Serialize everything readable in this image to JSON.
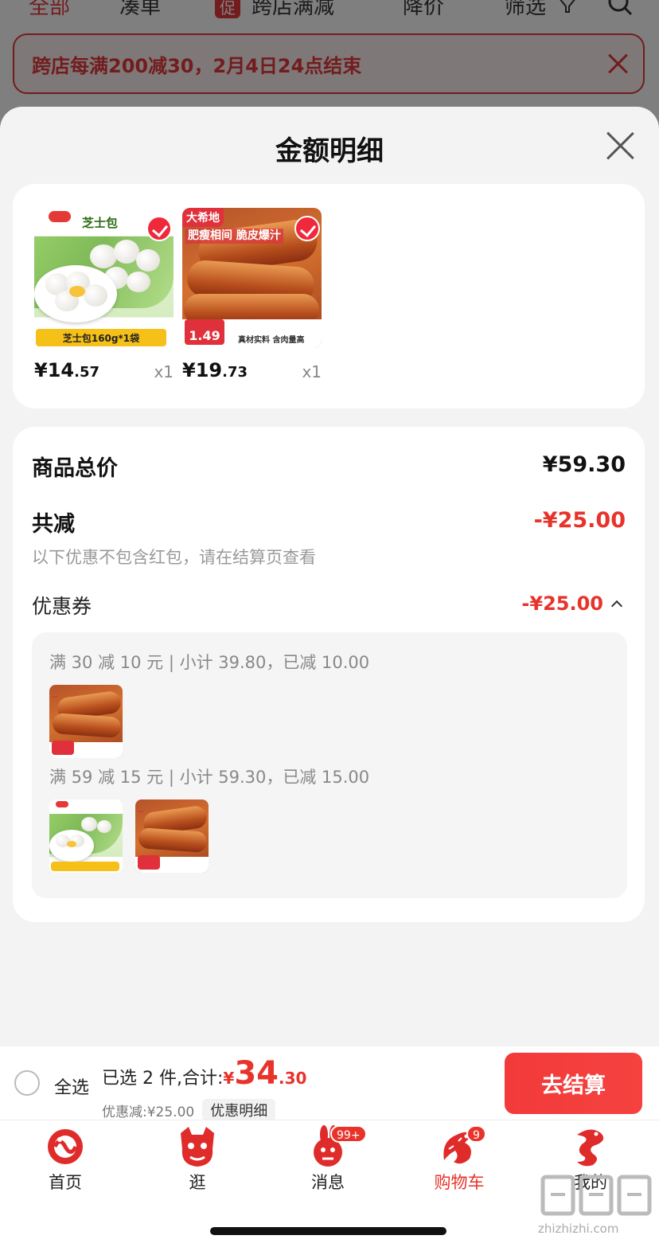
{
  "background": {
    "tabs": [
      "全部",
      "凑单",
      "跨店满减",
      "降价",
      "筛选"
    ],
    "promo_badge": "促",
    "banner_text": "跨店每满200减30，2月4日24点结束"
  },
  "sheet": {
    "title": "金额明细",
    "products": [
      {
        "name": "芝士包",
        "image_caption": "芝士包160g*1袋",
        "price_main": "¥14",
        "price_decimal": ".57",
        "qty": "x1"
      },
      {
        "name": "大希地",
        "slogan": "肥瘦相间 脆皮爆汁",
        "price_tag": "1.49",
        "image_caption": "真材实料 含肉量高",
        "price_main": "¥19",
        "price_decimal": ".73",
        "qty": "x1"
      }
    ],
    "total_label": "商品总价",
    "total_value": "¥59.30",
    "reduce_label": "共减",
    "reduce_value": "-¥25.00",
    "reduce_note": "以下优惠不包含红包，请在结算页查看",
    "coupon_label": "优惠券",
    "coupon_value": "-¥25.00",
    "rules": [
      {
        "text": "满 30 减 10 元 | 小计 39.80，已减 10.00"
      },
      {
        "text": "满 59 减 15 元 | 小计 59.30，已减 15.00"
      }
    ]
  },
  "checkout": {
    "select_all": "全选",
    "selected_text": "已选 2 件,合计:",
    "currency": "¥",
    "total_big": "34",
    "total_small": ".30",
    "discount_text": "优惠减:¥25.00",
    "detail_chip": "优惠明细",
    "pay_button": "去结算"
  },
  "tabbar": {
    "items": [
      {
        "label": "首页",
        "icon": "papercut-snake-icon"
      },
      {
        "label": "逛",
        "icon": "papercut-lion-icon"
      },
      {
        "label": "消息",
        "icon": "papercut-rabbit-icon",
        "badge": "99+"
      },
      {
        "label": "购物车",
        "icon": "papercut-dragon-icon",
        "badge": "9"
      },
      {
        "label": "我的",
        "icon": "papercut-snake-icon"
      }
    ]
  },
  "watermark": {
    "url": "zhizhizhi.com"
  },
  "colors": {
    "accent": "#e8332b",
    "button": "#f23a3a",
    "papercut": "#e02b2b"
  }
}
